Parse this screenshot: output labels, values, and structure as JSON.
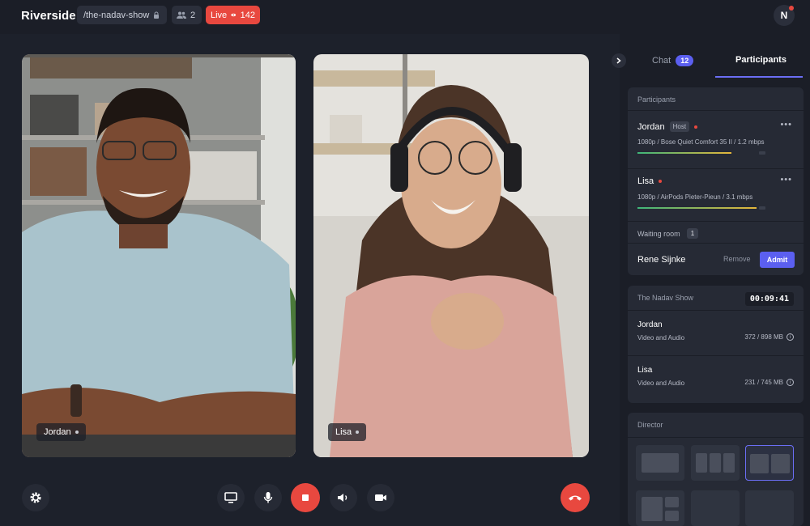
{
  "app": {
    "brand": "Riverside"
  },
  "header": {
    "studio_slug": "/the-nadav-show",
    "participant_count": "2",
    "live_label": "Live",
    "viewer_count": "142",
    "user_initial": "N"
  },
  "stage": {
    "tiles": [
      {
        "name": "Jordan"
      },
      {
        "name": "Lisa"
      }
    ]
  },
  "sidebar": {
    "tabs": [
      {
        "label": "Chat",
        "badge": "12"
      },
      {
        "label": "Participants"
      }
    ],
    "participants_card": {
      "heading": "Participants",
      "people": [
        {
          "name": "Jordan",
          "tag": "Host",
          "meta": "1080p / Bose Quiet Comfort 35 II / 1.2 mbps",
          "level": 0.75
        },
        {
          "name": "Lisa",
          "tag": "",
          "meta": "1080p / AirPods Pieter-Pieun / 3.1 mbps",
          "level": 0.95
        }
      ],
      "waiting_room_label": "Waiting room",
      "waiting_count": "1",
      "waiting_person": "Rene Sijnke",
      "remove_label": "Remove",
      "admit_label": "Admit"
    },
    "recording_card": {
      "title": "The Nadav Show",
      "timer": "00:09:41",
      "tracks": [
        {
          "name": "Jordan",
          "type": "Video and Audio",
          "size": "372 / 898 MB"
        },
        {
          "name": "Lisa",
          "type": "Video and Audio",
          "size": "231 / 745 MB"
        }
      ]
    },
    "director_card": {
      "heading": "Director"
    }
  },
  "icons": {
    "lock": "lock-icon",
    "people": "people-icon",
    "eye": "eye-icon",
    "settings": "gear-icon",
    "screen": "screen-share-icon",
    "mic": "microphone-icon",
    "record": "stop-record-icon",
    "speaker": "speaker-icon",
    "camera": "camera-icon",
    "hangup": "hang-up-icon",
    "chevron": "chevron-right-icon",
    "more": "more-icon",
    "info": "info-icon"
  },
  "colors": {
    "accent": "#5b5ff0",
    "live": "#e8483f",
    "background": "#1b1e27",
    "panel": "#262a35"
  }
}
